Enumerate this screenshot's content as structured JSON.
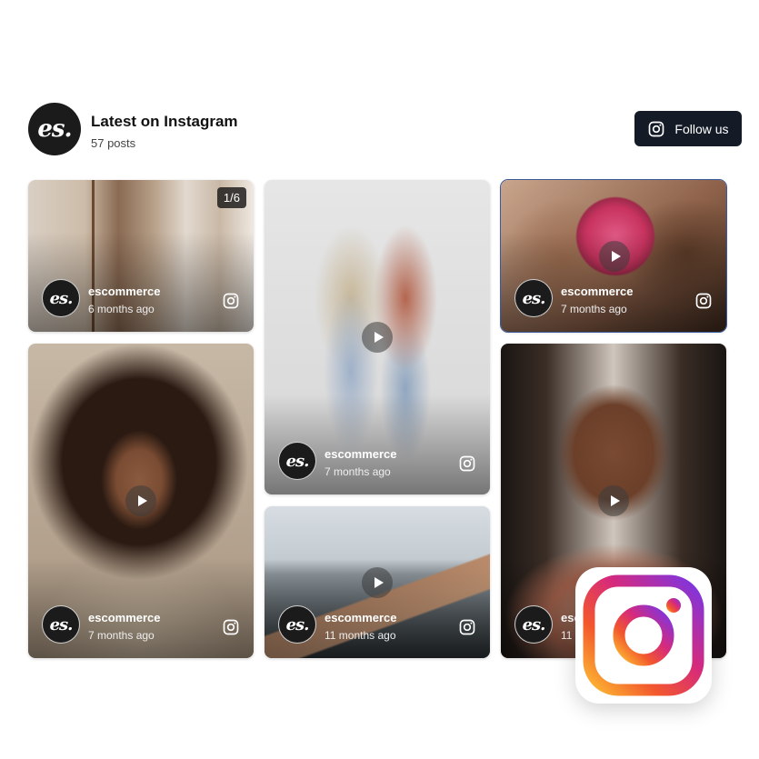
{
  "header": {
    "logo_text": "es.",
    "title": "Latest on Instagram",
    "posts_count": "57 posts",
    "follow_label": "Follow us"
  },
  "posts": [
    {
      "author": "escommerce",
      "ago": "6 months ago",
      "counter": "1/6",
      "avatar": "es."
    },
    {
      "author": "escommerce",
      "ago": "7 months ago",
      "avatar": "es."
    },
    {
      "author": "escommerce",
      "ago": "7 months ago",
      "avatar": "es."
    },
    {
      "author": "escommerce",
      "ago": "7 months ago",
      "avatar": "es."
    },
    {
      "author": "escommerce",
      "ago": "11 months ago",
      "avatar": "es."
    },
    {
      "author": "escommerce",
      "ago": "11 months ago",
      "avatar": "es."
    }
  ],
  "icons": {
    "instagram": "instagram-icon",
    "play": "play-icon"
  },
  "colors": {
    "button_bg": "#141b27",
    "selected_outline": "#3a5a9c"
  }
}
